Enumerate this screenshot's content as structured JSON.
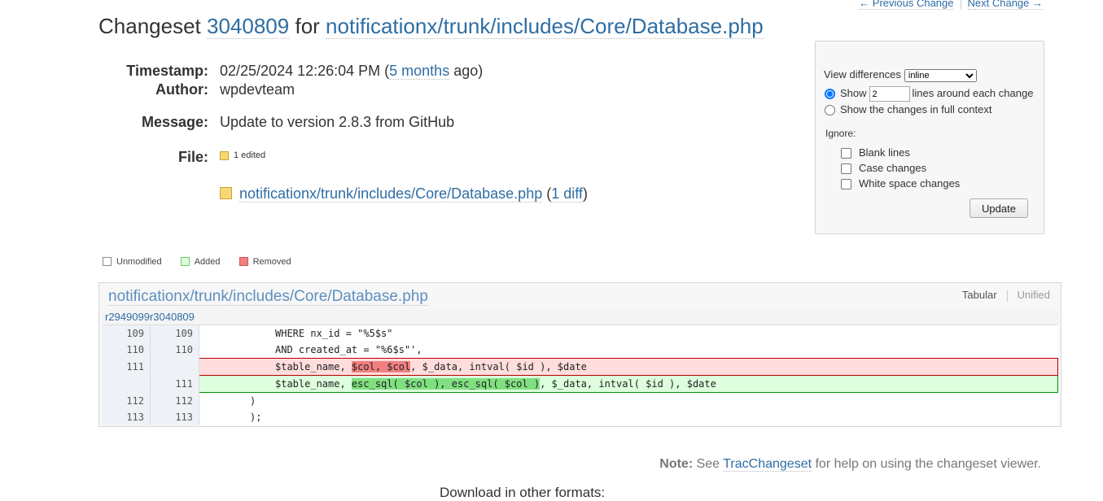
{
  "nav": {
    "prev_label": "← Previous Change",
    "next_label": "Next Change →"
  },
  "title": {
    "prefix": "Changeset",
    "revision": "3040809",
    "middle": "for",
    "path": "notificationx/trunk/includes/Core/Database.php"
  },
  "overview": {
    "timestamp_label": "Timestamp:",
    "timestamp_value": "02/25/2024 12:26:04 PM (",
    "timestamp_ago_link": "5 months",
    "timestamp_ago_suffix": "ago)",
    "author_label": "Author:",
    "author_value": "wpdevteam",
    "message_label": "Message:",
    "message_value": "Update to version 2.8.3 from GitHub",
    "files_label": "File:",
    "files_summary": "1 edited",
    "file_path": "notificationx/trunk/includes/Core/Database.php",
    "file_diff_open": "(",
    "file_diff_link": "1 diff",
    "file_diff_close": ")"
  },
  "prefs": {
    "view_label": "View differences",
    "view_selected": "inline",
    "show_label": "Show",
    "context_lines": "2",
    "around_label": "lines around each change",
    "full_context_label": "Show the changes in full context",
    "ignore_label": "Ignore:",
    "ignore_blank": "Blank lines",
    "ignore_case": "Case changes",
    "ignore_whitespace": "White space changes",
    "update_button": "Update"
  },
  "legend": {
    "unmodified": "Unmodified",
    "added": "Added",
    "removed": "Removed",
    "colors": {
      "unmodified": "#ffffff",
      "added": "#ddffdd",
      "removed": "#f08080"
    }
  },
  "diff": {
    "file_title": "notificationx/trunk/includes/Core/Database.php",
    "view_tabular": "Tabular",
    "view_unified": "Unified",
    "rev_old": "r2949099",
    "rev_new": "r3040809",
    "lines": [
      {
        "old": "109",
        "new": "109",
        "code": "WHERE nx_id = \"%5$s\""
      },
      {
        "old": "110",
        "new": "110",
        "code": "AND created_at = \"%6$s\"',"
      },
      {
        "old": "111",
        "new": "",
        "pre": "$table_name, ",
        "mark": "$col, $col",
        "post": ", $_data, intval( $id ), $date"
      },
      {
        "old": "",
        "new": "111",
        "pre": "$table_name, ",
        "mark": "esc_sql( $col ), esc_sql( $col )",
        "post": ", $_data, intval( $id ), $date"
      },
      {
        "old": "112",
        "new": "112",
        "code": ")"
      },
      {
        "old": "113",
        "new": "113",
        "code": ");"
      }
    ]
  },
  "note": {
    "bold": "Note:",
    "see": "See",
    "link": "TracChangeset",
    "rest": "for help on using the changeset viewer."
  },
  "footer": {
    "download_heading": "Download in other formats:"
  }
}
